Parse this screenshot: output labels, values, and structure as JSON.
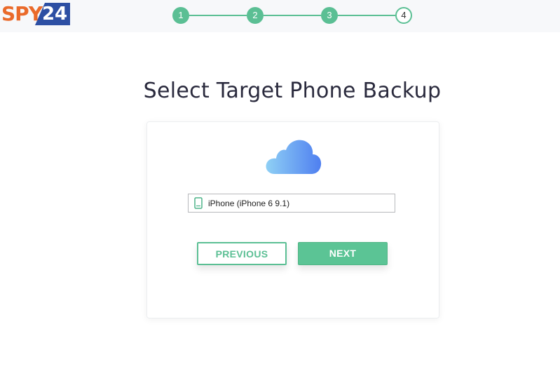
{
  "logo": {
    "part1": "SPY",
    "part2": "24"
  },
  "stepper": {
    "steps": [
      "1",
      "2",
      "3",
      "4"
    ],
    "current": 4,
    "accent_color": "#5bbf94"
  },
  "title": "Select Target Phone Backup",
  "card": {
    "icon": "icloud-icon",
    "device_select": {
      "icon": "phone-icon",
      "value": "iPhone (iPhone 6 9.1)"
    },
    "buttons": {
      "previous": "PREVIOUS",
      "next": "NEXT"
    }
  },
  "colors": {
    "brand_orange": "#ea6a2a",
    "brand_blue": "#2d4fa3",
    "accent_green": "#5bbf94"
  }
}
